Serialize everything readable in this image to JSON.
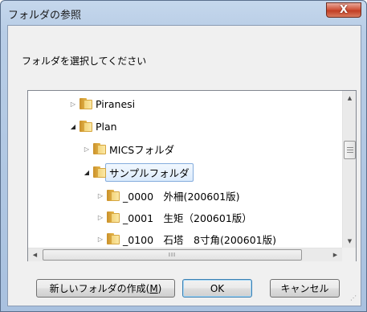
{
  "window": {
    "title": "フォルダの参照",
    "close_label": "X"
  },
  "instruction": "フォルダを選択してください",
  "tree": {
    "nodes": [
      {
        "label": "Piranesi",
        "expanded": false,
        "level": 1
      },
      {
        "label": "Plan",
        "expanded": true,
        "level": 1
      },
      {
        "label": "MICSフォルダ",
        "expanded": false,
        "level": 2
      },
      {
        "label": "サンプルフォルダ",
        "expanded": true,
        "level": 2,
        "selected": true
      },
      {
        "label": "_0000　外柵(200601版)",
        "expanded": false,
        "level": 3
      },
      {
        "label": "_0001　生矩（200601版）",
        "expanded": false,
        "level": 3
      },
      {
        "label": "_0100　石塔　8寸角(200601版)",
        "expanded": false,
        "level": 3
      }
    ],
    "hscroll_thumb_label": "III"
  },
  "buttons": {
    "new_folder": {
      "label": "新しいフォルダの作成(",
      "mnemonic": "M",
      "suffix": ")"
    },
    "ok": "OK",
    "cancel": "キャンセル"
  },
  "colors": {
    "title_bar": "#b8cde6",
    "close_button": "#c23e24",
    "selection_border": "#84acdd",
    "folder_icon": "#e8b74a"
  }
}
